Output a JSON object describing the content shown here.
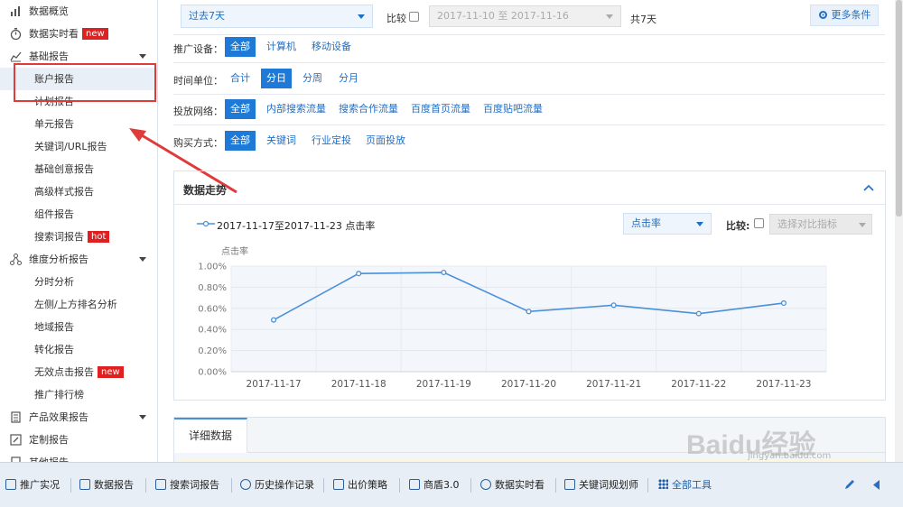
{
  "sidebar": {
    "items": [
      {
        "label": "数据概览"
      },
      {
        "label": "数据实时看",
        "badge": "new"
      },
      {
        "label": "基础报告"
      },
      {
        "label": "账户报告"
      },
      {
        "label": "计划报告"
      },
      {
        "label": "单元报告"
      },
      {
        "label": "关键词/URL报告"
      },
      {
        "label": "基础创意报告"
      },
      {
        "label": "高级样式报告"
      },
      {
        "label": "组件报告"
      },
      {
        "label": "搜索词报告",
        "badge": "hot"
      },
      {
        "label": "维度分析报告"
      },
      {
        "label": "分时分析"
      },
      {
        "label": "左侧/上方排名分析"
      },
      {
        "label": "地域报告"
      },
      {
        "label": "转化报告"
      },
      {
        "label": "无效点击报告",
        "badge": "new"
      },
      {
        "label": "推广排行榜"
      },
      {
        "label": "产品效果报告"
      },
      {
        "label": "定制报告"
      },
      {
        "label": "其他报告"
      }
    ]
  },
  "filters": {
    "time_range": "过去7天",
    "compare_label": "比较",
    "date_range": "2017-11-10 至 2017-11-16",
    "days_count": "共7天",
    "more_conditions": "更多条件",
    "device": {
      "label": "推广设备：",
      "options": [
        "全部",
        "计算机",
        "移动设备"
      ]
    },
    "time_unit": {
      "label": "时间单位：",
      "options": [
        "合计",
        "分日",
        "分周",
        "分月"
      ]
    },
    "network": {
      "label": "投放网络：",
      "options": [
        "全部",
        "内部搜索流量",
        "搜索合作流量",
        "百度首页流量",
        "百度贴吧流量"
      ]
    },
    "purchase": {
      "label": "购买方式：",
      "options": [
        "全部",
        "关键词",
        "行业定投",
        "页面投放"
      ]
    }
  },
  "trend": {
    "title": "数据走势",
    "legend": "2017-11-17至2017-11-23 点击率",
    "metric_select": "点击率",
    "compare_label": "比较:",
    "compare_placeholder": "选择对比指标"
  },
  "chart_data": {
    "type": "line",
    "ylabel": "点击率",
    "x": [
      "2017-11-17",
      "2017-11-18",
      "2017-11-19",
      "2017-11-20",
      "2017-11-21",
      "2017-11-22",
      "2017-11-23"
    ],
    "series": [
      {
        "name": "2017-11-17至2017-11-23 点击率",
        "values": [
          0.49,
          0.93,
          0.94,
          0.57,
          0.63,
          0.55,
          0.65
        ]
      }
    ],
    "ylim": [
      0,
      1.0
    ],
    "yticks": [
      "0.00%",
      "0.20%",
      "0.40%",
      "0.60%",
      "0.80%",
      "1.00%"
    ],
    "color": "#4a90d9",
    "grid": true
  },
  "detail": {
    "tab": "详细数据"
  },
  "toolbar": {
    "items": [
      "推广实况",
      "数据报告",
      "搜索词报告",
      "历史操作记录",
      "出价策略",
      "商盾3.0",
      "数据实时看",
      "关键词规划师",
      "全部工具"
    ]
  },
  "watermark": {
    "brand": "Baidu经验",
    "url": "jingyan.baidu.com"
  }
}
